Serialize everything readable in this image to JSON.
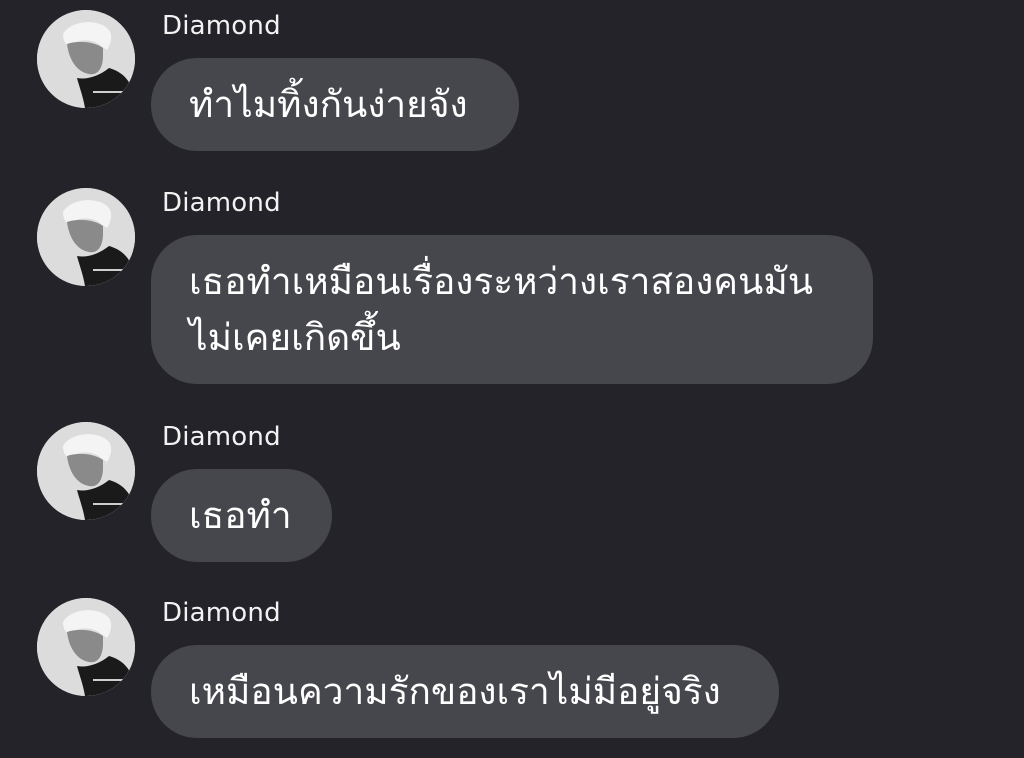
{
  "colors": {
    "background": "#232329",
    "bubble": "#46464d",
    "text": "#ffffff"
  },
  "messages": [
    {
      "sender": "Diamond",
      "avatar_icon": "user-avatar-photo",
      "text": "ทำไมทิ้งกันง่ายจัง"
    },
    {
      "sender": "Diamond",
      "avatar_icon": "user-avatar-photo",
      "text": "เธอทำเหมือนเรื่องระหว่างเราสองคนมัน\nไม่เคยเกิดขึ้น"
    },
    {
      "sender": "Diamond",
      "avatar_icon": "user-avatar-photo",
      "text": "เธอทำ"
    },
    {
      "sender": "Diamond",
      "avatar_icon": "user-avatar-photo",
      "text": "เหมือนความรักของเราไม่มีอยู่จริง"
    }
  ]
}
